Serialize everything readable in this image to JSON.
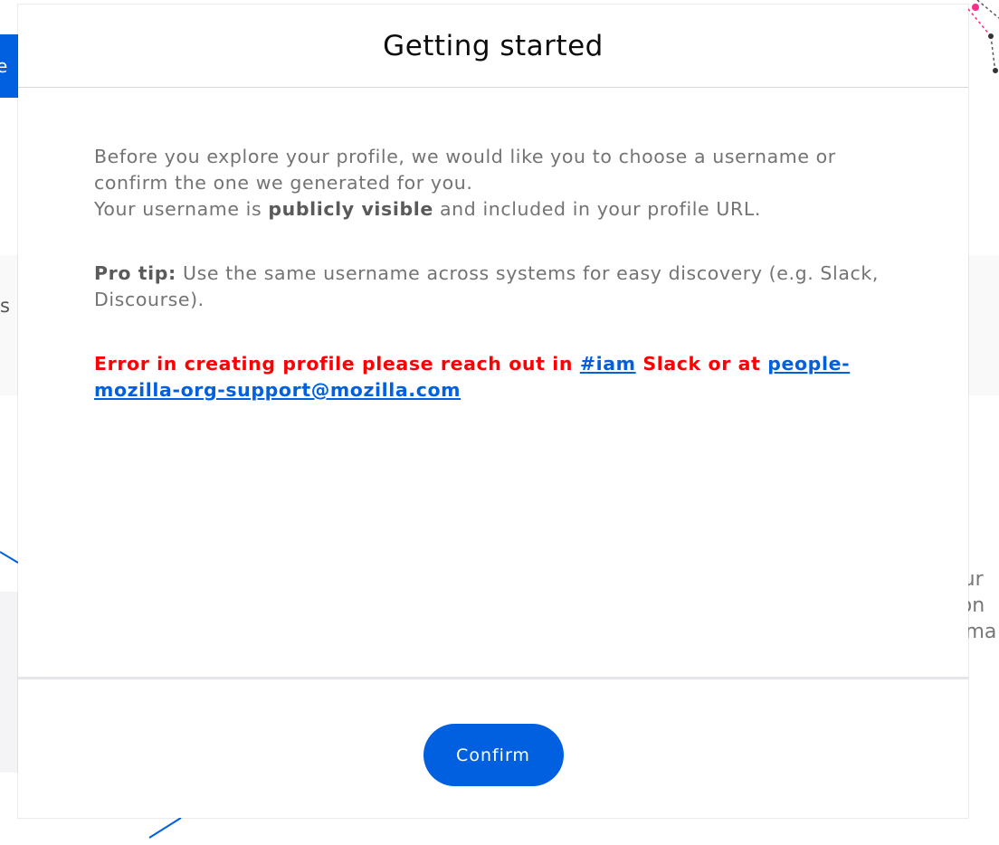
{
  "modal": {
    "title": "Getting started",
    "intro_line1": "Before you explore your profile, we would like you to choose a username or confirm the one we generated for you.",
    "intro_line2_before": "Your username is ",
    "intro_line2_bold": "publicly visible",
    "intro_line2_after": " and included in your profile URL.",
    "tip_label": "Pro tip:",
    "tip_text": " Use the same username across systems for easy discovery (e.g. Slack, Discourse).",
    "error_before": "Error in creating profile please reach out in ",
    "error_slack_link": "#iam",
    "error_middle": " Slack or at ",
    "error_email_link": "people-mozilla-org-support@mozilla.com",
    "confirm_label": "Confirm"
  },
  "background": {
    "nav_button_fragment": "e",
    "band_text_fragment": "s",
    "right_text_fragment": "rtur\ntion\no ma"
  },
  "colors": {
    "accent": "#0060df",
    "error": "#ff0000",
    "body_text": "#737373"
  }
}
